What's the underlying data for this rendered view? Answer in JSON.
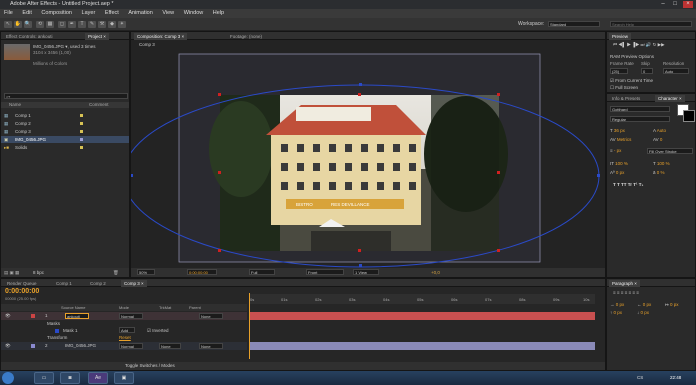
{
  "window": {
    "title": "Adobe After Effects - Untitled Project.aep *",
    "min": "–",
    "max": "□",
    "close": "×"
  },
  "menu": [
    "File",
    "Edit",
    "Composition",
    "Layer",
    "Effect",
    "Animation",
    "View",
    "Window",
    "Help"
  ],
  "workspace": {
    "label": "Workspace:",
    "value": "Standard"
  },
  "search_help": {
    "placeholder": "Search Help"
  },
  "tools": [
    "↖",
    "✋",
    "🔍",
    "⟲",
    "▦",
    "◻",
    "✒",
    "T",
    "✎",
    "⚒",
    "◆",
    "✴"
  ],
  "project": {
    "tabs": [
      "Effect Controls: ankouti",
      "Project ×"
    ],
    "item_name": "IMG_0456.JPG ▾, used 3 times",
    "item_info": "3104 x 3456 (1,00)",
    "item_colors": "Millions of Colors",
    "search_placeholder": "ρ▾",
    "col_name": "Name",
    "col_comment": "Comment",
    "items": [
      "Comp 1",
      "Comp 2",
      "Comp 3",
      "IMG_0456.JPG",
      "Solids"
    ],
    "bpc": "8 bpc"
  },
  "viewer": {
    "tabs": [
      "Composition: Comp 3 ×",
      "Footage: (none)"
    ],
    "crumb": "Comp 3",
    "zoom": "50%",
    "timecode": "0:00:00:00",
    "res": "Full",
    "view": "Front",
    "views": "1 View",
    "exposure": "+0,0",
    "sign_left": "BISTRO",
    "sign_right": "RES DEVILLANCE"
  },
  "preview": {
    "title": "Preview",
    "ram": "RAM Preview Options",
    "frame_rate_label": "Frame Rate",
    "skip_label": "Skip",
    "resolution_label": "Resolution",
    "frame_rate": "(25)",
    "skip": "0",
    "resolution": "Auto",
    "from_current": "From Current Time",
    "full_screen": "Full Screen"
  },
  "character": {
    "tabs": [
      "Info & Presets",
      "Character ×"
    ],
    "font": "Gotthard",
    "style": "Regular",
    "size": "36 px",
    "leading": "Auto",
    "kern": "Metrics",
    "track": "0",
    "stroke": "- px",
    "stroke_mode": "Fill Over Stroke",
    "vscale": "100 %",
    "hscale": "100 %",
    "baseline": "0 px",
    "tsume": "0 %"
  },
  "paragraph": {
    "title": "Paragraph ×",
    "v1": "0 px",
    "v2": "0 px",
    "v3": "0 px",
    "v4": "0 px",
    "v5": "0 px"
  },
  "timeline": {
    "tabs": [
      "Render Queue",
      "Comp 1",
      "Comp 2",
      "Comp 3 ×"
    ],
    "timecode": "0:00:00:00",
    "frame_info": "00000 (25.00 fps)",
    "col_source": "Source Name",
    "col_mode": "Mode",
    "col_trkmat": "TrkMat",
    "col_parent": "Parent",
    "layer1_num": "1",
    "layer1_name": "ankouti",
    "layer1_mode": "Normal",
    "layer1_parent": "None",
    "masks_label": "Masks",
    "mask1_label": "Mask 1",
    "mask1_mode": "Add",
    "mask1_inverted": "Inverted",
    "transform_label": "Transform",
    "transform_reset": "Reset",
    "layer2_num": "2",
    "layer2_name": "IMG_0456.JPG",
    "layer2_mode": "Normal",
    "layer2_trkmat": "None",
    "layer2_parent": "None",
    "ticks": [
      "0s",
      "01s",
      "02s",
      "03s",
      "04s",
      "05s",
      "06s",
      "07s",
      "08s",
      "09s",
      "10s"
    ],
    "toggle": "Toggle Switches / Modes"
  },
  "taskbar": {
    "clock": "22:48",
    "lang": "CS"
  }
}
